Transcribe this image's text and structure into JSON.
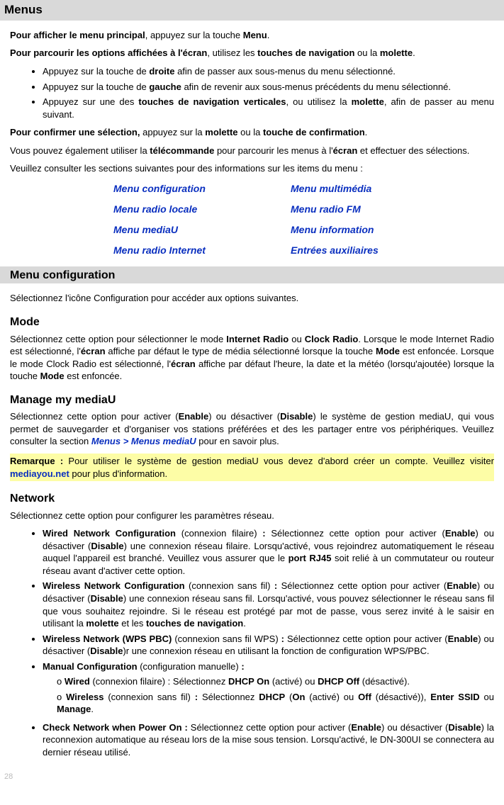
{
  "header": {
    "title": "Menus"
  },
  "intro": {
    "p1_a": "Pour afficher le menu principal",
    "p1_b": ", appuyez sur la touche ",
    "p1_c": "Menu",
    "p1_d": ".",
    "p2_a": "Pour parcourir les options affichées à l'écran",
    "p2_b": ", utilisez les ",
    "p2_c": "touches de navigation",
    "p2_d": " ou la ",
    "p2_e": "molette",
    "p2_f": ".",
    "bul1_a": "Appuyez sur la touche de ",
    "bul1_b": "droite",
    "bul1_c": " afin de passer aux sous-menus du menu sélectionné.",
    "bul2_a": "Appuyez sur la touche de ",
    "bul2_b": "gauche",
    "bul2_c": " afin de revenir aux sous-menus précédents du menu sélectionné.",
    "bul3_a": "Appuyez sur une des ",
    "bul3_b": "touches de navigation verticales",
    "bul3_c": ", ou utilisez la ",
    "bul3_d": "molette",
    "bul3_e": ", afin de passer au menu suivant.",
    "p3_a": "Pour confirmer une sélection,",
    "p3_b": " appuyez sur la ",
    "p3_c": "molette",
    "p3_d": " ou la ",
    "p3_e": "touche de confirmation",
    "p3_f": ".",
    "p4_a": "Vous pouvez également utiliser la ",
    "p4_b": "télécommande",
    "p4_c": " pour parcourir les menus à l'",
    "p4_d": "écran",
    "p4_e": " et effectuer des sélections.",
    "p5": "Veuillez consulter les sections suivantes pour des informations sur les items du menu :"
  },
  "menu_links": {
    "l11": "Menu configuration",
    "l12": "Menu multimédia",
    "l21": "Menu radio locale",
    "l22": "Menu radio FM",
    "l31": "Menu  mediaU",
    "l32": "Menu information",
    "l41": "Menu  radio Internet",
    "l42": "Entrées auxiliaires"
  },
  "config": {
    "bar": "Menu configuration",
    "intro": "Sélectionnez l'icône Configuration pour accéder aux options suivantes.",
    "mode_head": "Mode",
    "mode_a": "Sélectionnez cette option pour sélectionner le mode ",
    "mode_b": "Internet Radio",
    "mode_c": " ou ",
    "mode_d": "Clock Radio",
    "mode_e": ". Lorsque le mode Internet Radio est sélectionné, l'",
    "mode_f": "écran",
    "mode_g": " affiche par défaut le type de média sélectionné lorsque la touche ",
    "mode_h": "Mode",
    "mode_i": " est enfoncée. Lorsque le mode Clock Radio est sélectionné, l'",
    "mode_j": "écran",
    "mode_k": " affiche par défaut l'heure, la date et la météo (lorsqu'ajoutée) lorsque la touche ",
    "mode_l": "Mode",
    "mode_m": " est enfoncée.",
    "mediau_head": "Manage my mediaU",
    "mediau_a": "Sélectionnez cette option pour activer (",
    "mediau_b": "Enable",
    "mediau_c": ") ou désactiver (",
    "mediau_d": "Disable",
    "mediau_e": ") le système de gestion mediaU, qui vous permet de sauvegarder et d'organiser vos stations préférées et des les partager entre vos périphériques. Veuillez consulter la section ",
    "mediau_link": "Menus > Menus mediaU",
    "mediau_f": " pour en savoir plus.",
    "note_a": "Remarque :",
    "note_b": " Pour utiliser le système de gestion mediaU vous devez d'abord créer un compte. Veuillez visiter ",
    "note_link": "mediayou.net",
    "note_c": " pour plus d'information.",
    "net_head": "Network",
    "net_intro": "Sélectionnez cette option pour configurer les paramètres réseau.",
    "net1_a": "Wired Network Configuration",
    "net1_b": " (connexion filaire) ",
    "net1_c": ":",
    "net1_d": " Sélectionnez cette option pour activer (",
    "net1_e": "Enable",
    "net1_f": ") ou désactiver (",
    "net1_g": "Disable",
    "net1_h": ") une connexion réseau filaire. Lorsqu'activé, vous rejoindrez automatiquement le réseau auquel l'appareil est branché. Veuillez vous assurer que le ",
    "net1_i": "port RJ45",
    "net1_j": " soit relié à un commutateur ou routeur réseau avant d'activer cette option.",
    "net2_a": "Wireless Network Configuration",
    "net2_b": " (connexion sans fil) ",
    "net2_c": ":",
    "net2_d": " Sélectionnez cette option pour activer (",
    "net2_e": "Enable",
    "net2_f": ") ou désactiver (",
    "net2_g": "Disable",
    "net2_h": ") une connexion réseau sans fil. Lorsqu'activé, vous pouvez sélectionner le réseau sans fil que vous souhaitez rejoindre. Si le réseau est protégé par mot de passe, vous serez invité à le saisir en utilisant la ",
    "net2_i": "molette",
    "net2_j": " et les ",
    "net2_k": "touches de navigation",
    "net2_l": ".",
    "net3_a": "Wireless Network (WPS PBC)",
    "net3_b": " (connexion sans fil WPS) ",
    "net3_c": ":",
    "net3_d": " Sélectionnez cette option pour activer (",
    "net3_e": "Enable",
    "net3_f": ") ou désactiver (",
    "net3_g": "Disable",
    "net3_h": ")r une connexion réseau en utilisant la fonction de configuration WPS/PBC.",
    "net4_a": "Manual Configuration",
    "net4_b": " (configuration manuelle) ",
    "net4_c": ":",
    "net4s1_a": "Wired",
    "net4s1_b": " (connexion filaire) : Sélectionnez ",
    "net4s1_c": "DHCP On",
    "net4s1_d": " (activé) ou ",
    "net4s1_e": "DHCP Off",
    "net4s1_f": " (désactivé).",
    "net4s2_a": "Wireless",
    "net4s2_b": " (connexion sans fil) ",
    "net4s2_c": ":",
    "net4s2_d": " Sélectionnez ",
    "net4s2_e": "DHCP",
    "net4s2_f": " (",
    "net4s2_g": "On",
    "net4s2_h": " (activé) ou ",
    "net4s2_i": "Off",
    "net4s2_j": " (désactivé)), ",
    "net4s2_k": "Enter SSID",
    "net4s2_l": " ou ",
    "net4s2_m": "Manage",
    "net4s2_n": ".",
    "net5_a": "Check Network when Power On :",
    "net5_b": " Sélectionnez cette option pour activer (",
    "net5_c": "Enable",
    "net5_d": ") ou désactiver (",
    "net5_e": "Disable",
    "net5_f": ") la reconnexion automatique au réseau lors de la mise sous tension. Lorsqu'activé, le DN-300UI se connectera au dernier réseau utilisé."
  },
  "page_number": "28"
}
